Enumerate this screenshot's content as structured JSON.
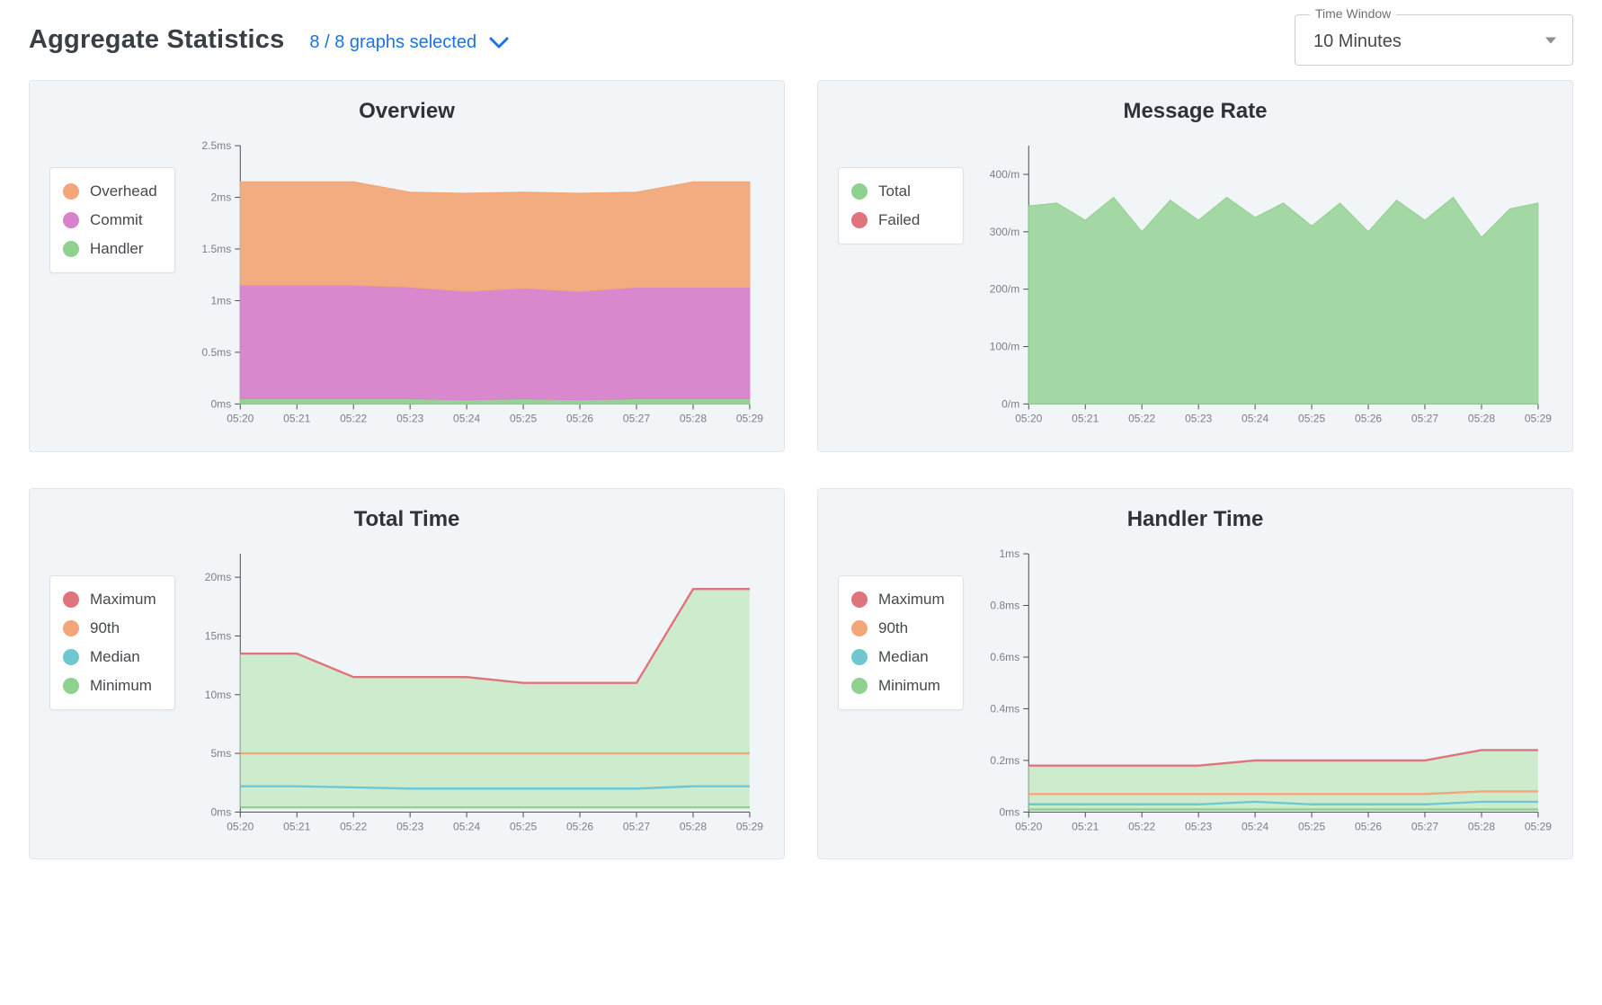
{
  "header": {
    "title": "Aggregate Statistics",
    "selected_text": "8 / 8 graphs selected"
  },
  "time_window": {
    "label": "Time Window",
    "value": "10 Minutes"
  },
  "colors": {
    "orange": "#f2a679",
    "pink": "#d882cb",
    "green": "#8fd18f",
    "red": "#e0747d",
    "teal": "#6fc7d1",
    "green_area": "#c9ebc9"
  },
  "x_ticks": [
    "05:20",
    "05:21",
    "05:22",
    "05:23",
    "05:24",
    "05:25",
    "05:26",
    "05:27",
    "05:28",
    "05:29"
  ],
  "panels": {
    "overview": {
      "title": "Overview",
      "legend": [
        {
          "label": "Overhead",
          "color": "orange"
        },
        {
          "label": "Commit",
          "color": "pink"
        },
        {
          "label": "Handler",
          "color": "green"
        }
      ],
      "y_axis": {
        "ticks": [
          0,
          0.5,
          1,
          1.5,
          2,
          2.5
        ],
        "labels": [
          "0ms",
          "0.5ms",
          "1ms",
          "1.5ms",
          "2ms",
          "2.5ms"
        ],
        "max": 2.5
      }
    },
    "message_rate": {
      "title": "Message Rate",
      "legend": [
        {
          "label": "Total",
          "color": "green"
        },
        {
          "label": "Failed",
          "color": "red"
        }
      ],
      "y_axis": {
        "ticks": [
          0,
          100,
          200,
          300,
          400
        ],
        "labels": [
          "0/m",
          "100/m",
          "200/m",
          "300/m",
          "400/m"
        ],
        "max": 450
      }
    },
    "total_time": {
      "title": "Total Time",
      "legend": [
        {
          "label": "Maximum",
          "color": "red"
        },
        {
          "label": "90th",
          "color": "orange"
        },
        {
          "label": "Median",
          "color": "teal"
        },
        {
          "label": "Minimum",
          "color": "green"
        }
      ],
      "y_axis": {
        "ticks": [
          0,
          5,
          10,
          15,
          20
        ],
        "labels": [
          "0ms",
          "5ms",
          "10ms",
          "15ms",
          "20ms"
        ],
        "max": 22
      }
    },
    "handler_time": {
      "title": "Handler Time",
      "legend": [
        {
          "label": "Maximum",
          "color": "red"
        },
        {
          "label": "90th",
          "color": "orange"
        },
        {
          "label": "Median",
          "color": "teal"
        },
        {
          "label": "Minimum",
          "color": "green"
        }
      ],
      "y_axis": {
        "ticks": [
          0,
          0.2,
          0.4,
          0.6,
          0.8,
          1
        ],
        "labels": [
          "0ms",
          "0.2ms",
          "0.4ms",
          "0.6ms",
          "0.8ms",
          "1ms"
        ],
        "max": 1
      }
    }
  },
  "chart_data": [
    {
      "id": "overview",
      "title": "Overview",
      "type": "area",
      "stacked": true,
      "x_type": "category",
      "categories": [
        "05:20",
        "05:21",
        "05:22",
        "05:23",
        "05:24",
        "05:25",
        "05:26",
        "05:27",
        "05:28",
        "05:29"
      ],
      "ylabel": "ms",
      "ylim": [
        0,
        2.5
      ],
      "series": [
        {
          "name": "Handler",
          "color": "#8fd18f",
          "values": [
            0.05,
            0.05,
            0.05,
            0.05,
            0.04,
            0.05,
            0.04,
            0.05,
            0.05,
            0.05
          ]
        },
        {
          "name": "Commit",
          "color": "#d882cb",
          "values": [
            1.1,
            1.1,
            1.1,
            1.08,
            1.05,
            1.07,
            1.05,
            1.08,
            1.08,
            1.08
          ]
        },
        {
          "name": "Overhead",
          "color": "#f2a679",
          "values": [
            1.0,
            1.0,
            1.0,
            0.92,
            0.95,
            0.93,
            0.95,
            0.92,
            1.02,
            1.02
          ]
        }
      ]
    },
    {
      "id": "message_rate",
      "title": "Message Rate",
      "type": "area",
      "stacked": false,
      "x_type": "time",
      "x": [
        "05:20",
        "05:20.5",
        "05:21",
        "05:21.5",
        "05:22",
        "05:22.5",
        "05:23",
        "05:23.5",
        "05:24",
        "05:24.5",
        "05:25",
        "05:25.5",
        "05:26",
        "05:26.5",
        "05:27",
        "05:27.5",
        "05:28",
        "05:28.5",
        "05:29"
      ],
      "ylabel": "/m",
      "ylim": [
        0,
        450
      ],
      "series": [
        {
          "name": "Total",
          "color": "#8fd18f",
          "values": [
            345,
            350,
            320,
            360,
            300,
            355,
            320,
            360,
            325,
            350,
            310,
            350,
            300,
            355,
            320,
            360,
            290,
            340,
            350
          ]
        },
        {
          "name": "Failed",
          "color": "#e0747d",
          "values": [
            0,
            0,
            0,
            0,
            0,
            0,
            0,
            0,
            0,
            0,
            0,
            0,
            0,
            0,
            0,
            0,
            0,
            0,
            0
          ]
        }
      ]
    },
    {
      "id": "total_time",
      "title": "Total Time",
      "type": "line",
      "x_type": "category",
      "categories": [
        "05:20",
        "05:21",
        "05:22",
        "05:23",
        "05:24",
        "05:25",
        "05:26",
        "05:27",
        "05:28",
        "05:29"
      ],
      "ylabel": "ms",
      "ylim": [
        0,
        22
      ],
      "series": [
        {
          "name": "Maximum",
          "color": "#e0747d",
          "values": [
            13.5,
            13.5,
            11.5,
            11.5,
            11.5,
            11.0,
            11.0,
            11.0,
            19.0,
            19.0
          ]
        },
        {
          "name": "90th",
          "color": "#f2a679",
          "values": [
            5.0,
            5.0,
            5.0,
            5.0,
            5.0,
            5.0,
            5.0,
            5.0,
            5.0,
            5.0
          ]
        },
        {
          "name": "Median",
          "color": "#6fc7d1",
          "values": [
            2.2,
            2.2,
            2.1,
            2.0,
            2.0,
            2.0,
            2.0,
            2.0,
            2.2,
            2.2
          ]
        },
        {
          "name": "Minimum",
          "color": "#8fd18f",
          "values": [
            0.4,
            0.4,
            0.4,
            0.4,
            0.4,
            0.4,
            0.4,
            0.4,
            0.4,
            0.4
          ]
        }
      ],
      "fill_between": {
        "upper": "Maximum",
        "lower": "Minimum",
        "color": "#c9ebc9"
      }
    },
    {
      "id": "handler_time",
      "title": "Handler Time",
      "type": "line",
      "x_type": "category",
      "categories": [
        "05:20",
        "05:21",
        "05:22",
        "05:23",
        "05:24",
        "05:25",
        "05:26",
        "05:27",
        "05:28",
        "05:29"
      ],
      "ylabel": "ms",
      "ylim": [
        0,
        1
      ],
      "series": [
        {
          "name": "Maximum",
          "color": "#e0747d",
          "values": [
            0.18,
            0.18,
            0.18,
            0.18,
            0.2,
            0.2,
            0.2,
            0.2,
            0.24,
            0.24
          ]
        },
        {
          "name": "90th",
          "color": "#f2a679",
          "values": [
            0.07,
            0.07,
            0.07,
            0.07,
            0.07,
            0.07,
            0.07,
            0.07,
            0.08,
            0.08
          ]
        },
        {
          "name": "Median",
          "color": "#6fc7d1",
          "values": [
            0.03,
            0.03,
            0.03,
            0.03,
            0.04,
            0.03,
            0.03,
            0.03,
            0.04,
            0.04
          ]
        },
        {
          "name": "Minimum",
          "color": "#8fd18f",
          "values": [
            0.01,
            0.01,
            0.01,
            0.01,
            0.01,
            0.01,
            0.01,
            0.01,
            0.01,
            0.01
          ]
        }
      ],
      "fill_between": {
        "upper": "Maximum",
        "lower": "Minimum",
        "color": "#c9ebc9"
      }
    }
  ]
}
